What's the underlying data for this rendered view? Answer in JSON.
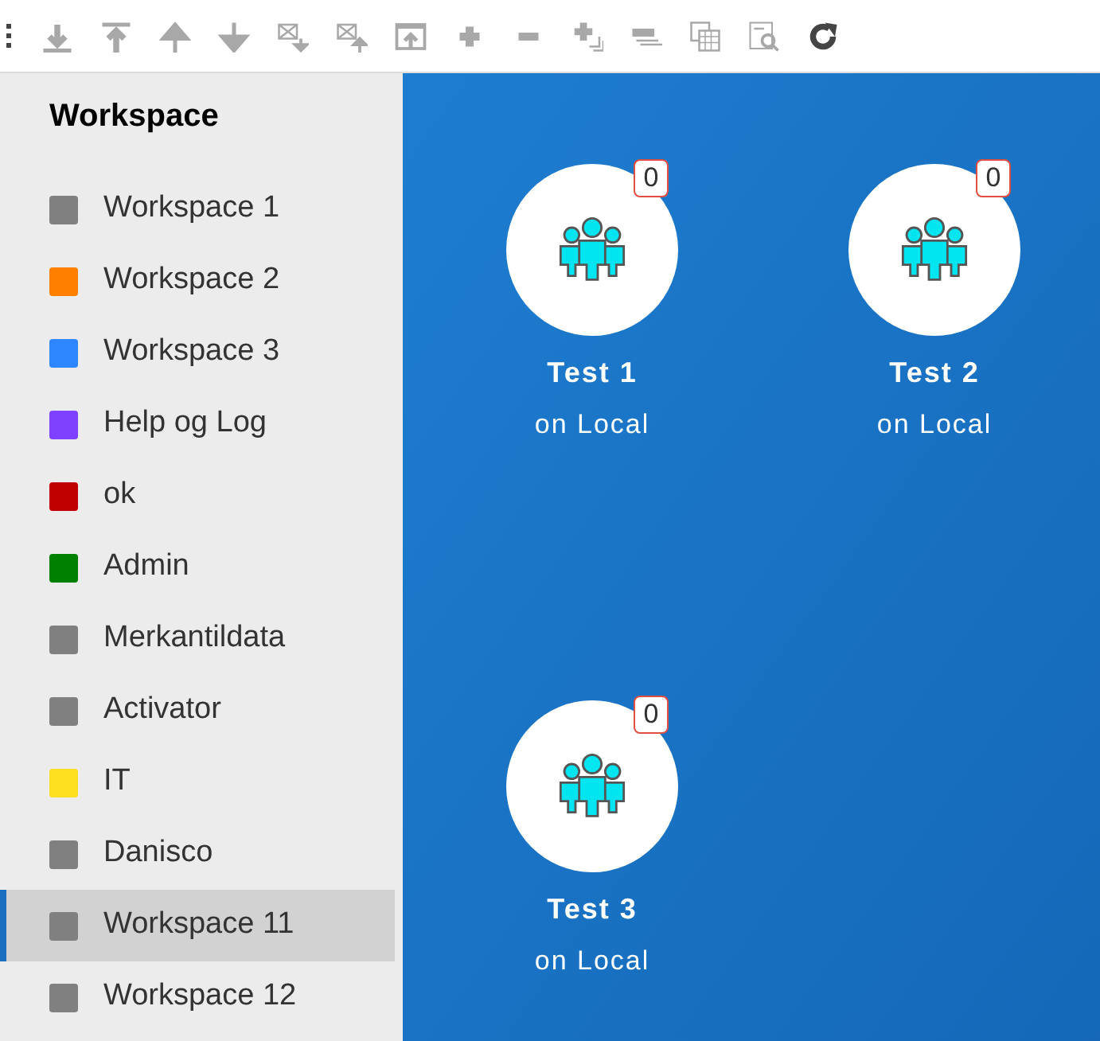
{
  "toolbar": {
    "buttons": [
      {
        "disabled": true
      },
      {
        "disabled": true
      },
      {
        "disabled": true
      },
      {
        "disabled": true
      },
      {
        "disabled": true
      },
      {
        "disabled": true
      },
      {
        "disabled": true
      },
      {
        "disabled": true
      },
      {
        "disabled": true
      },
      {
        "disabled": true
      },
      {
        "disabled": true
      },
      {
        "disabled": true
      },
      {
        "disabled": true
      },
      {
        "disabled": false
      }
    ]
  },
  "sidebar": {
    "title": "Workspace",
    "items": [
      {
        "label": "Workspace 1",
        "color": "#808080",
        "selected": false
      },
      {
        "label": "Workspace 2",
        "color": "#ff8000",
        "selected": false
      },
      {
        "label": "Workspace 3",
        "color": "#2f87ff",
        "selected": false
      },
      {
        "label": "Help og Log",
        "color": "#8040ff",
        "selected": false
      },
      {
        "label": "ok",
        "color": "#c00000",
        "selected": false
      },
      {
        "label": "Admin",
        "color": "#008000",
        "selected": false
      },
      {
        "label": "Merkantildata",
        "color": "#808080",
        "selected": false
      },
      {
        "label": "Activator",
        "color": "#808080",
        "selected": false
      },
      {
        "label": "IT",
        "color": "#ffe020",
        "selected": false
      },
      {
        "label": "Danisco",
        "color": "#808080",
        "selected": false
      },
      {
        "label": "Workspace 11",
        "color": "#808080",
        "selected": true
      },
      {
        "label": "Workspace 12",
        "color": "#808080",
        "selected": false
      }
    ]
  },
  "nodes": [
    {
      "name": "Test 1",
      "location": "on Local",
      "count": "0"
    },
    {
      "name": "Test 2",
      "location": "on Local",
      "count": "0"
    },
    {
      "name": "Test 3",
      "location": "on Local",
      "count": "0"
    }
  ]
}
